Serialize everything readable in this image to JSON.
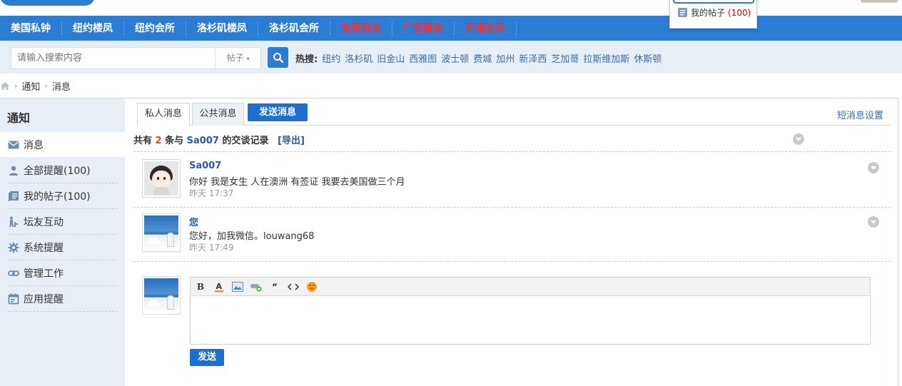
{
  "popup": {
    "label": "我的帖子",
    "count": "(100)"
  },
  "nav": {
    "items": [
      {
        "label": "美国私钟",
        "red": false
      },
      {
        "label": "纽约楼凤",
        "red": false
      },
      {
        "label": "纽约会所",
        "red": false
      },
      {
        "label": "洛杉矶楼凤",
        "red": false
      },
      {
        "label": "洛杉矶会所",
        "red": false
      },
      {
        "label": "免责协议",
        "red": true
      },
      {
        "label": "广告服务",
        "red": true
      },
      {
        "label": "开通会员",
        "red": true
      }
    ]
  },
  "search": {
    "placeholder": "请输入搜索内容",
    "type_label": "帖子",
    "hot_label": "热搜:",
    "hot_links": [
      "纽约",
      "洛杉矶",
      "旧金山",
      "西雅图",
      "波士顿",
      "费城",
      "加州",
      "新泽西",
      "芝加哥",
      "拉斯维加斯",
      "休斯顿"
    ]
  },
  "breadcrumb": {
    "items": [
      "通知",
      "消息"
    ]
  },
  "sidebar": {
    "title": "通知",
    "active": {
      "label": "消息",
      "icon": "mail-icon"
    },
    "items": [
      {
        "label": "全部提醒(100)",
        "icon": "person-icon"
      },
      {
        "label": "我的帖子(100)",
        "icon": "posts-icon"
      },
      {
        "label": "坛友互动",
        "icon": "interaction-icon"
      },
      {
        "label": "系统提醒",
        "icon": "gear-icon"
      },
      {
        "label": "管理工作",
        "icon": "link-icon"
      },
      {
        "label": "应用提醒",
        "icon": "calendar-icon"
      }
    ]
  },
  "tabs": {
    "private": "私人消息",
    "public": "公共消息",
    "send": "发送消息",
    "settings": "短消息设置"
  },
  "summary": {
    "prefix": "共有",
    "count": "2",
    "middle": "条与",
    "user": "Sa007",
    "suffix": "的交谈记录",
    "export": "[导出]"
  },
  "messages": [
    {
      "name": "Sa007",
      "text": "你好 我是女生 人在澳洲 有签证 我要去美国做三个月",
      "time": "昨天 17:37"
    },
    {
      "name": "您",
      "text": "您好，加我微信。louwang68",
      "time": "昨天 17:49"
    }
  ],
  "composer": {
    "send_label": "发送"
  },
  "colors": {
    "brand": "#2b7cd3",
    "nav_red": "#ff2a2a",
    "link": "#3a6ea8",
    "count_red": "#e04a2d"
  }
}
